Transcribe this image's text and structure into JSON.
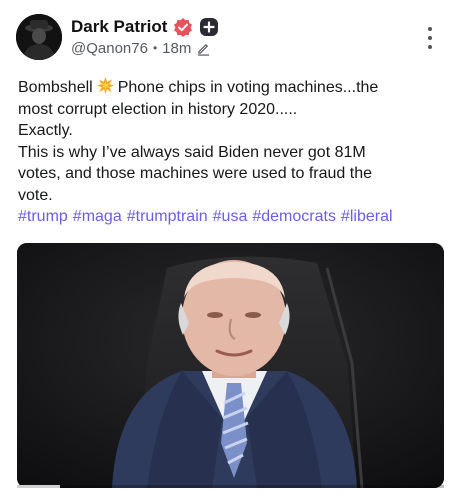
{
  "author": {
    "display_name": "Dark Patriot",
    "handle": "@Qanon76",
    "time": "18m",
    "separator": "•"
  },
  "icons": {
    "avatar": "masked-figure-avatar",
    "verified": "verified-badge-icon",
    "follow": "plus-badge-icon",
    "edited": "pencil-icon",
    "more": "more-vertical-icon",
    "emoji": "collision-emoji"
  },
  "post": {
    "line1_before": "Bombshell",
    "line1_after": "Phone chips in voting machines...the",
    "line2": "most corrupt election in history 2020.....",
    "line3": "Exactly.",
    "line4": "This is why I’ve always said Biden never got 81M",
    "line5": "votes, and those machines were used to fraud the",
    "line6": "vote.",
    "hashtags": [
      "#trump",
      "#maga",
      "#trumptrain",
      "#usa",
      "#democrats",
      "#liberal"
    ]
  },
  "media": {
    "type": "video",
    "progress": 0.1
  },
  "colors": {
    "hashtag": "#6a5de8",
    "verified": "#e8505b",
    "follow_badge": "#2b2b33",
    "muted_text": "#555a5f"
  }
}
